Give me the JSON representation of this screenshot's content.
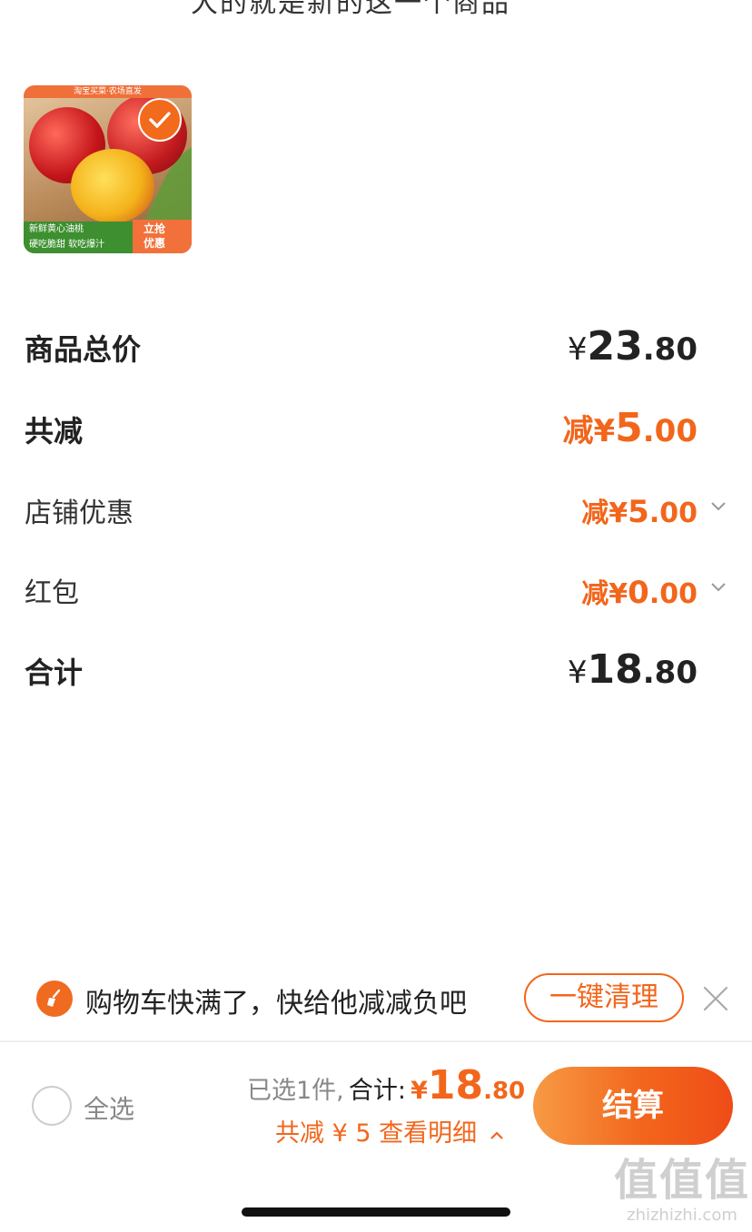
{
  "header": {
    "cut_text": "大的就是新的这一个商品"
  },
  "product": {
    "image_banner": "淘宝买菜·农场直发",
    "image_label_line1": "新鲜黄心油桃",
    "image_label_line2": "硬吃脆甜 软吃爆汁",
    "image_cta": "立抢\n优惠",
    "selected": true
  },
  "summary": {
    "goods_total": {
      "label": "商品总价",
      "symbol": "¥",
      "int": "23",
      "dec": ".80"
    },
    "total_discount": {
      "label": "共减",
      "prefix": "减",
      "symbol": "¥",
      "int": "5",
      "dec": ".00"
    },
    "shop_discount": {
      "label": "店铺优惠",
      "prefix": "减",
      "symbol": "¥",
      "int": "5",
      "dec": ".00"
    },
    "red_packet": {
      "label": "红包",
      "prefix": "减",
      "symbol": "¥",
      "int": "0",
      "dec": ".00"
    },
    "total": {
      "label": "合计",
      "symbol": "¥",
      "int": "18",
      "dec": ".80"
    }
  },
  "hint_bar": {
    "text": "购物车快满了，快给他减减负吧",
    "clean_button": "一键清理",
    "icon": "broom-icon"
  },
  "bottom_bar": {
    "select_all": "全选",
    "selected_count": "已选1件,",
    "total_label": "合计:",
    "total_symbol": "¥",
    "total_int": "18",
    "total_dec": ".80",
    "discount_detail": "共减 ¥ 5  查看明细",
    "checkout_button": "结算"
  },
  "watermark": {
    "big": "值值值",
    "small": "zhizhizhi.com"
  },
  "colors": {
    "accent": "#f2661c",
    "text": "#222222",
    "muted": "#888888"
  }
}
